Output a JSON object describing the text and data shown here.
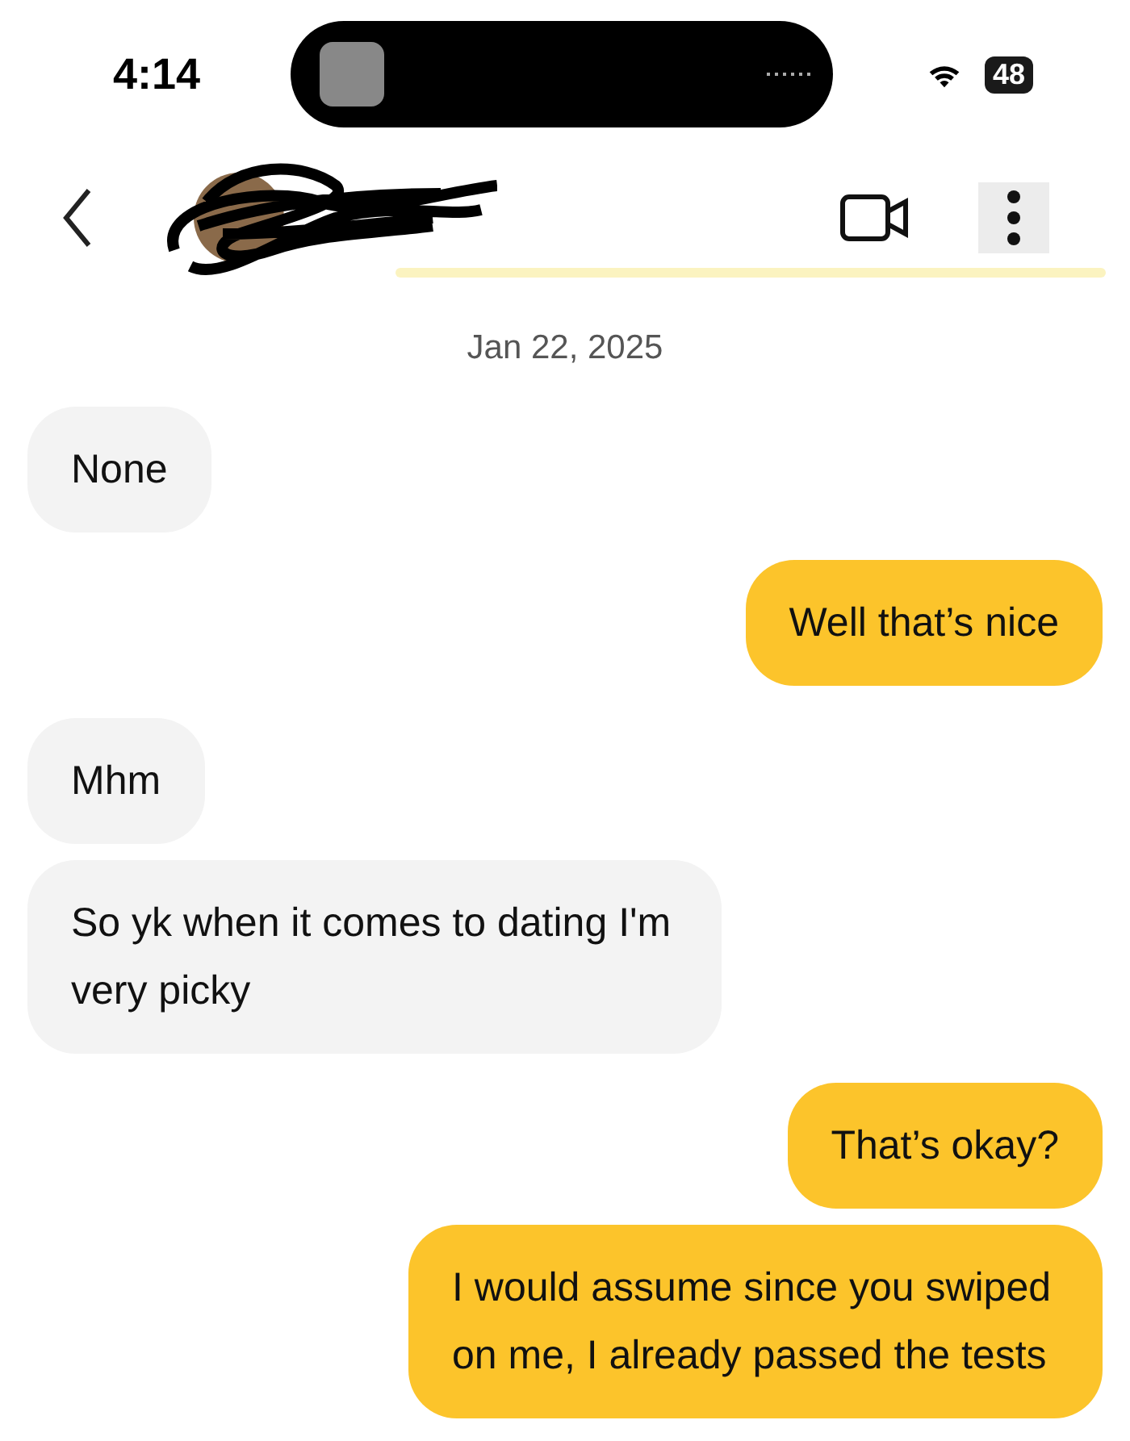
{
  "status_bar": {
    "time": "4:14",
    "battery": "48"
  },
  "date": "Jan 22, 2025",
  "messages": [
    {
      "kind": "received",
      "text": "None"
    },
    {
      "kind": "sent",
      "text": "Well that’s nice"
    },
    {
      "kind": "received",
      "text": "Mhm"
    },
    {
      "kind": "received",
      "text": "So yk when it comes to dating I'm very picky"
    },
    {
      "kind": "sent",
      "text": "That’s okay?"
    },
    {
      "kind": "sent",
      "text": "I would assume since you swiped on me, I already passed the tests"
    }
  ]
}
